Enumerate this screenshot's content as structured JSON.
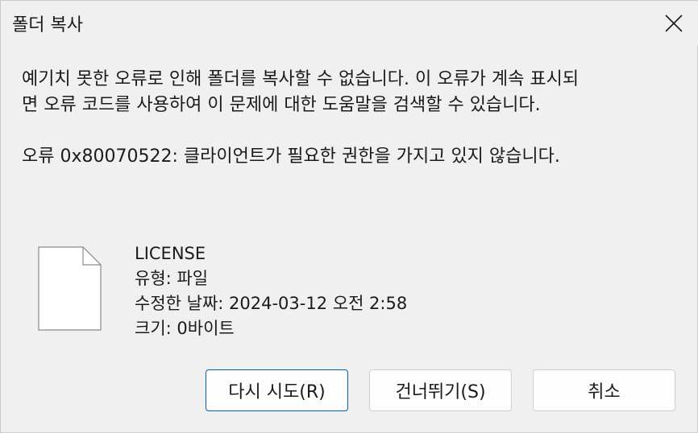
{
  "window": {
    "title": "폴더 복사",
    "close_icon": "close-icon"
  },
  "message": {
    "text": "예기치 못한 오류로 인해 폴더를 복사할 수 없습니다. 이 오류가 계속 표시되\n면 오류 코드를 사용하여 이 문제에 대한 도움말을 검색할 수 있습니다.",
    "error": "오류 0x80070522: 클라이언트가 필요한 권한을 가지고 있지 않습니다."
  },
  "file": {
    "icon": "document-icon",
    "name": "LICENSE",
    "type": "유형: 파일",
    "modified": "수정한 날짜: 2024-03-12 오전 2:58",
    "size": "크기: 0바이트"
  },
  "buttons": {
    "retry": "다시 시도(R)",
    "skip": "건너뛰기(S)",
    "cancel": "취소"
  },
  "colors": {
    "accent": "#005fb8",
    "background": "#f0f0f0"
  }
}
